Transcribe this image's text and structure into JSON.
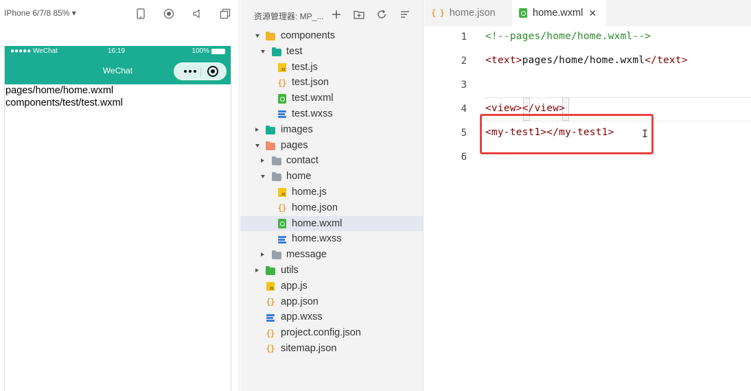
{
  "simulator": {
    "device": "IPhone 6/7/8 85% ▾",
    "status": {
      "carrier": "●●●●● WeChat",
      "time": "16:19",
      "battery": "100%"
    },
    "nav_title": "WeChat",
    "page_lines": [
      "pages/home/home.wxml",
      "components/test/test.wxml"
    ]
  },
  "explorer": {
    "title": "资源管理器: MP_...",
    "tree": [
      {
        "label": "components",
        "icon": "folder-icon",
        "color": "#f0b429",
        "depth": 0,
        "arrow": "down"
      },
      {
        "label": "test",
        "icon": "folder-icon",
        "color": "#1aad94",
        "depth": 1,
        "arrow": "down"
      },
      {
        "label": "test.js",
        "icon": "js-file-icon",
        "depth": 2
      },
      {
        "label": "test.json",
        "icon": "json-file-icon",
        "depth": 2
      },
      {
        "label": "test.wxml",
        "icon": "wxml-file-icon",
        "depth": 2
      },
      {
        "label": "test.wxss",
        "icon": "wxss-file-icon",
        "depth": 2
      },
      {
        "label": "images",
        "icon": "folder-icon",
        "color": "#1aad94",
        "depth": 0,
        "arrow": "right"
      },
      {
        "label": "pages",
        "icon": "folder-icon",
        "color": "#f28b6b",
        "depth": 0,
        "arrow": "down"
      },
      {
        "label": "contact",
        "icon": "folder-icon",
        "color": "#9aa0a6",
        "depth": 1,
        "arrow": "right"
      },
      {
        "label": "home",
        "icon": "folder-icon",
        "color": "#9aa0a6",
        "depth": 1,
        "arrow": "down"
      },
      {
        "label": "home.js",
        "icon": "js-file-icon",
        "depth": 2
      },
      {
        "label": "home.json",
        "icon": "json-file-icon",
        "depth": 2
      },
      {
        "label": "home.wxml",
        "icon": "wxml-file-icon",
        "depth": 2,
        "selected": true
      },
      {
        "label": "home.wxss",
        "icon": "wxss-file-icon",
        "depth": 2
      },
      {
        "label": "message",
        "icon": "folder-icon",
        "color": "#9aa0a6",
        "depth": 1,
        "arrow": "right"
      },
      {
        "label": "utils",
        "icon": "folder-icon",
        "color": "#3fb33f",
        "depth": 0,
        "arrow": "right"
      },
      {
        "label": "app.js",
        "icon": "js-file-icon",
        "depth": 0
      },
      {
        "label": "app.json",
        "icon": "json-file-icon",
        "depth": 0
      },
      {
        "label": "app.wxss",
        "icon": "wxss-file-icon",
        "depth": 0
      },
      {
        "label": "project.config.json",
        "icon": "json-file-icon",
        "depth": 0
      },
      {
        "label": "sitemap.json",
        "icon": "json-file-icon",
        "depth": 0
      }
    ]
  },
  "editor": {
    "tabs": [
      {
        "label": "home.json",
        "active": false
      },
      {
        "label": "home.wxml",
        "active": true,
        "close": "✕"
      }
    ],
    "lines": [
      {
        "num": "1",
        "parts": [
          {
            "t": "<!--pages/home/home.wxml-->",
            "c": "comment"
          }
        ]
      },
      {
        "num": "2",
        "parts": [
          {
            "t": "<text>",
            "c": "tag"
          },
          {
            "t": "pages/home/home.wxml",
            "c": "text"
          },
          {
            "t": "</text>",
            "c": "tag"
          }
        ]
      },
      {
        "num": "3",
        "parts": []
      },
      {
        "num": "4",
        "parts": [
          {
            "t": "<view></view>",
            "c": "tag"
          }
        ]
      },
      {
        "num": "5",
        "parts": [
          {
            "t": "<my-test1></my-test1>",
            "c": "tag"
          }
        ]
      },
      {
        "num": "6",
        "parts": []
      }
    ],
    "cursor_glyph": "I"
  },
  "colors": {
    "nav_bar": "#1aad94",
    "highlight_box": "#e8423f",
    "selected_row": "#e4e6f1",
    "comment": "#2e8b2e",
    "tag": "#800000"
  }
}
